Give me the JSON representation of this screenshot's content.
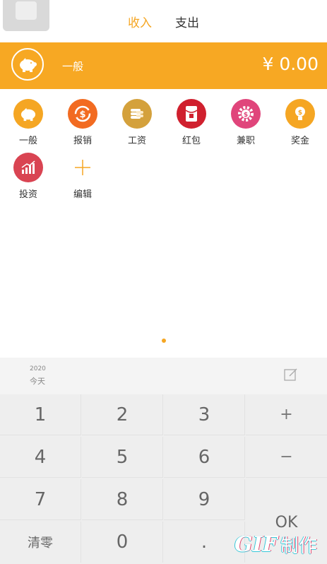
{
  "tabs": {
    "income": "收入",
    "expense": "支出"
  },
  "amount_bar": {
    "category": "一般",
    "amount": "¥ 0.00",
    "color": "#f7a823"
  },
  "categories": [
    {
      "label": "一般",
      "icon": "piggy-bank-icon",
      "color": "#f5a623"
    },
    {
      "label": "报销",
      "icon": "refund-icon",
      "color": "#f26b21"
    },
    {
      "label": "工资",
      "icon": "coins-stack-icon",
      "color": "#d4a13c"
    },
    {
      "label": "红包",
      "icon": "red-envelope-icon",
      "color": "#d0202e"
    },
    {
      "label": "兼职",
      "icon": "gear-coin-icon",
      "color": "#e0457b"
    },
    {
      "label": "奖金",
      "icon": "lightbulb-coin-icon",
      "color": "#f5a623"
    },
    {
      "label": "投资",
      "icon": "growth-chart-icon",
      "color": "#d94452"
    },
    {
      "label": "编辑",
      "icon": "plus-icon",
      "color": "#f5a623"
    }
  ],
  "date": {
    "year": "2020",
    "day": "今天"
  },
  "keypad": {
    "rows": [
      [
        "1",
        "2",
        "3",
        "+"
      ],
      [
        "4",
        "5",
        "6",
        "−"
      ],
      [
        "7",
        "8",
        "9",
        ""
      ],
      [
        "清零",
        "0",
        ".",
        "OK"
      ]
    ]
  },
  "watermark": {
    "brand": "GIF",
    "text": "制作"
  }
}
